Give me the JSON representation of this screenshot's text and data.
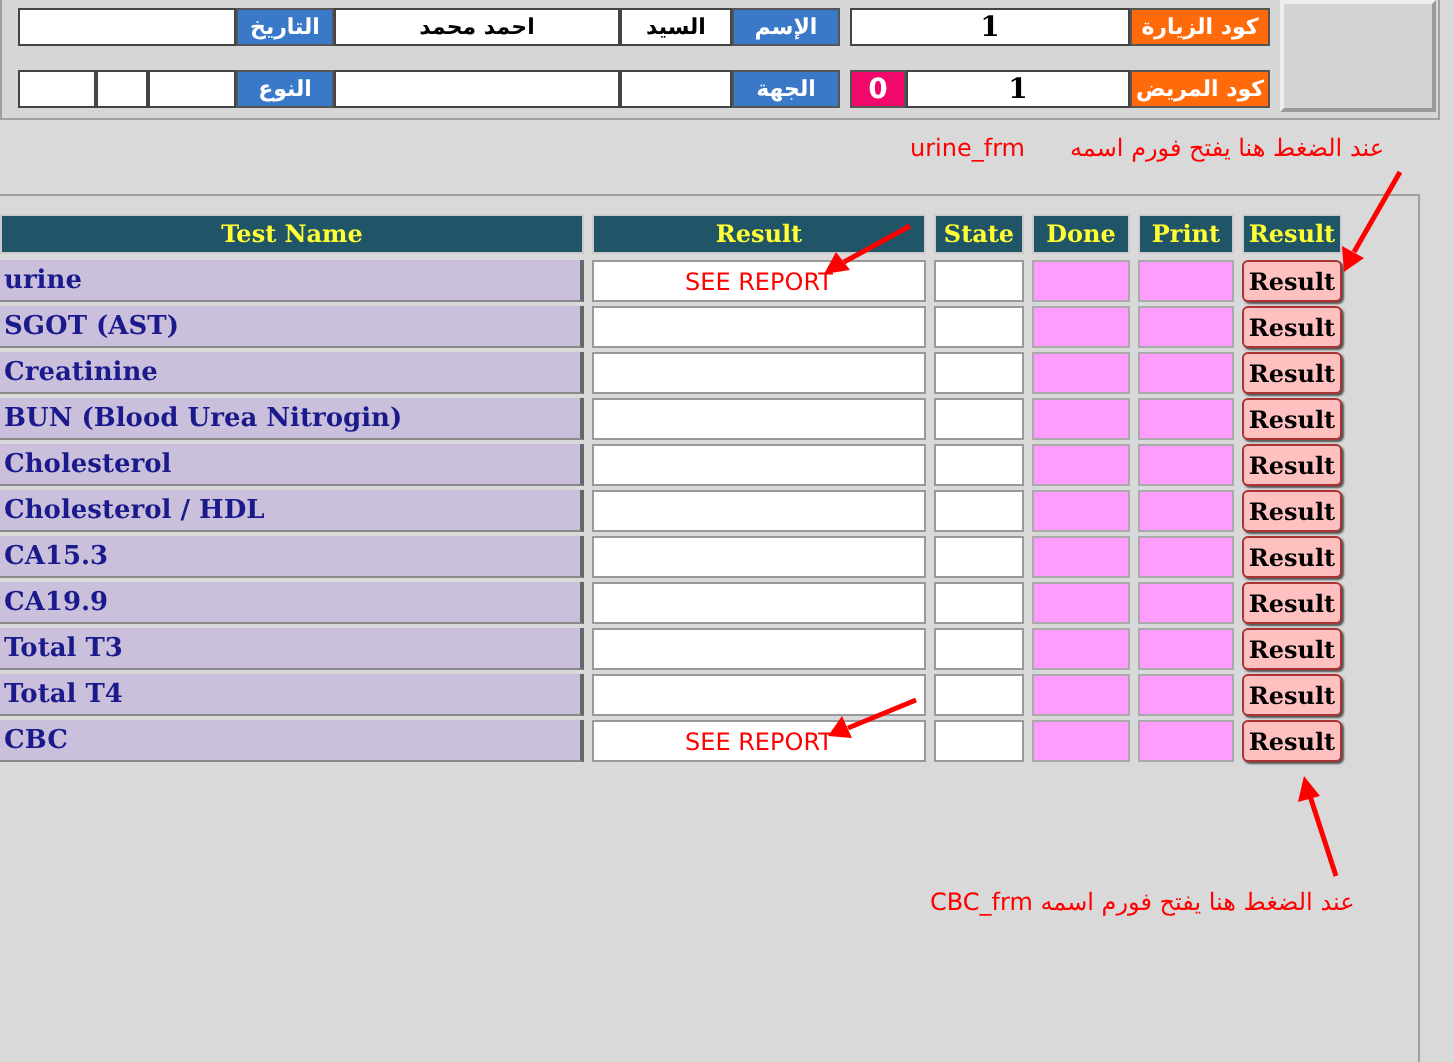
{
  "header": {
    "row_1": {
      "visit_code_label": "كود الزيارة",
      "visit_code": "1",
      "name_label": "الإسم",
      "title": "السيد",
      "name": "احمد محمد",
      "date_label": "التاريخ"
    },
    "row_2": {
      "patient_code_label": "كود المريض",
      "patient_code": "1",
      "count": "0",
      "party_label": "الجهة",
      "type_label": "النوع"
    }
  },
  "table": {
    "columns": [
      "Test Name",
      "Result",
      "State",
      "Done",
      "Print",
      "Result"
    ],
    "rows": [
      {
        "name": "urine",
        "result": "SEE REPORT",
        "button": "Result"
      },
      {
        "name": "SGOT (AST)",
        "button": "Result"
      },
      {
        "name": "Creatinine",
        "button": "Result"
      },
      {
        "name": "BUN (Blood Urea Nitrogin)",
        "button": "Result"
      },
      {
        "name": "Cholesterol",
        "button": "Result"
      },
      {
        "name": "Cholesterol / HDL",
        "button": "Result"
      },
      {
        "name": "CA15.3",
        "button": "Result"
      },
      {
        "name": "CA19.9",
        "button": "Result"
      },
      {
        "name": "Total T3",
        "button": "Result"
      },
      {
        "name": "Total T4",
        "button": "Result"
      },
      {
        "name": "CBC",
        "result": "SEE REPORT",
        "button": "Result"
      }
    ]
  },
  "annotations": {
    "top_note": "عند الضغط هنا يفتح فورم اسمه",
    "top_form": "urine_frm",
    "bottom_note": "عند الضغط هنا يفتح فورم اسمه CBC_frm"
  }
}
